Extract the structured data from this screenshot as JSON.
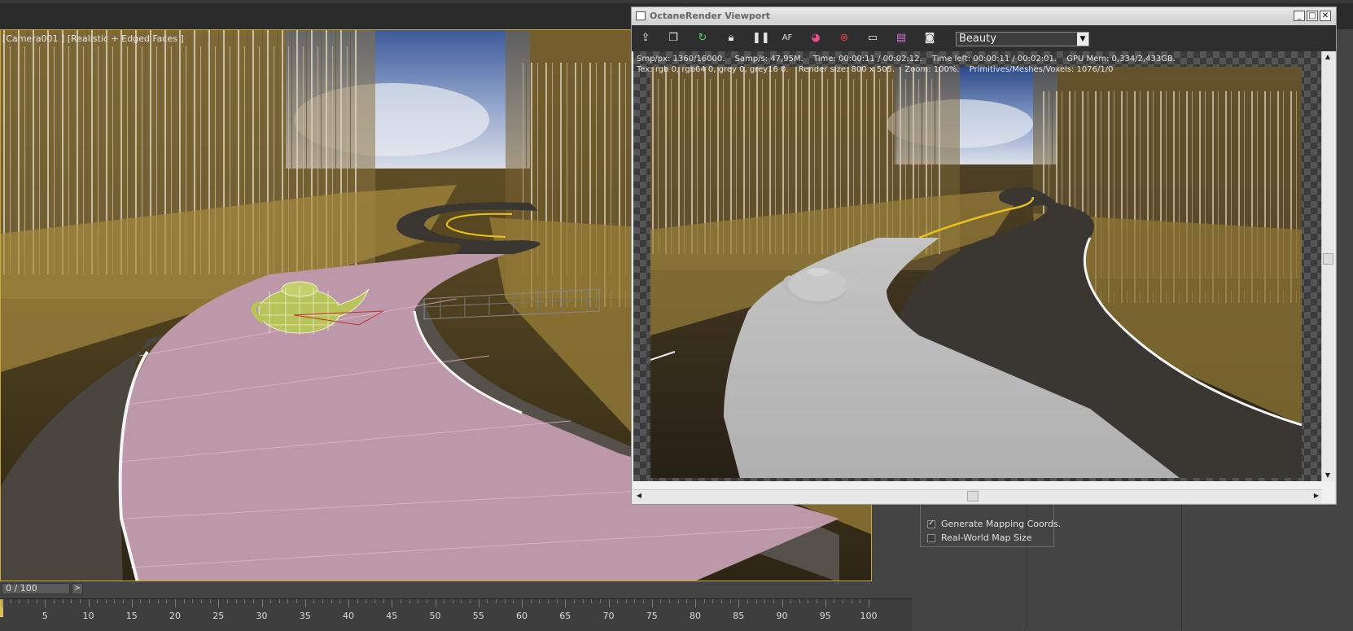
{
  "viewport": {
    "label": "[Camera001 ] [Realistic + Edged Faces ]"
  },
  "octane": {
    "title": "OctaneRender Viewport",
    "window_buttons": [
      "_",
      "□",
      "✕"
    ],
    "toolbar_icons": [
      "send-scene-icon",
      "copy-icon",
      "refresh-icon",
      "lock-icon",
      "pause-icon",
      "autofocus-icon",
      "color-icon",
      "region-icon",
      "monitor-icon",
      "print-icon",
      "camera-icon"
    ],
    "autofocus_label": "AF",
    "render_pass": "Beauty",
    "stats": {
      "line1": [
        "Smp/px: 1360/16000.",
        "Samp/s: 47,95M.",
        "Time: 00:00:11 / 00:02:12.",
        "Time left: 00:00:11 / 00:02:01.",
        "GPU Mem: 0,334/2,433GB."
      ],
      "line2": [
        "Tex: rgb 0, rgb64 0, grey 0, grey16 0.",
        "Render size: 800 x 505.",
        "Zoom: 100%.",
        "Primitives/Meshes/Voxels: 1076/1/0"
      ]
    }
  },
  "options": {
    "generate_mapping": {
      "label": "Generate Mapping Coords.",
      "checked": true
    },
    "real_world": {
      "label": "Real-World Map Size",
      "checked": false
    }
  },
  "timeline": {
    "slider_text": "0 / 100",
    "next_label": ">",
    "current_frame": 0,
    "ticks": [
      "5",
      "10",
      "15",
      "20",
      "25",
      "30",
      "35",
      "40",
      "45",
      "50",
      "55",
      "60",
      "65",
      "70",
      "75",
      "80",
      "85",
      "90",
      "95",
      "100"
    ]
  },
  "colors": {
    "viewport_border": "#c8a83a",
    "road_plane_pink": "#bd98a8",
    "teapot_green": "#b7c45a",
    "octane_toolbar": "#2e2e2e"
  }
}
